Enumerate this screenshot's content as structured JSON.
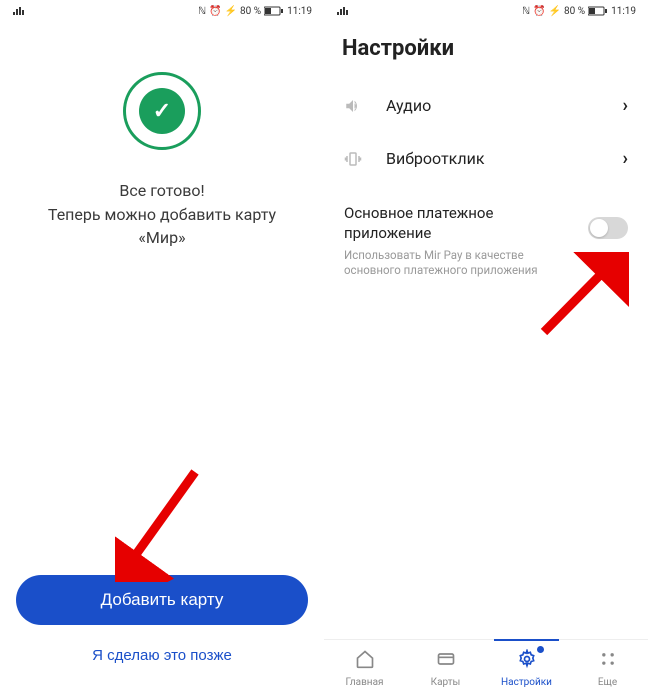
{
  "status": {
    "battery": "80 %",
    "time": "11:19"
  },
  "screen1": {
    "title": "Все готово!",
    "subtitle": "Теперь можно добавить карту «Мир»",
    "primary_btn": "Добавить карту",
    "secondary_btn": "Я сделаю это позже"
  },
  "screen2": {
    "header": "Настройки",
    "rows": [
      {
        "label": "Аудио"
      },
      {
        "label": "Виброотклик"
      }
    ],
    "toggle": {
      "title": "Основное платежное приложение",
      "subtitle": "Использовать Mir Pay в качестве основного платежного приложения",
      "state": false
    },
    "nav": [
      {
        "label": "Главная"
      },
      {
        "label": "Карты"
      },
      {
        "label": "Настройки"
      },
      {
        "label": "Еще"
      }
    ]
  }
}
